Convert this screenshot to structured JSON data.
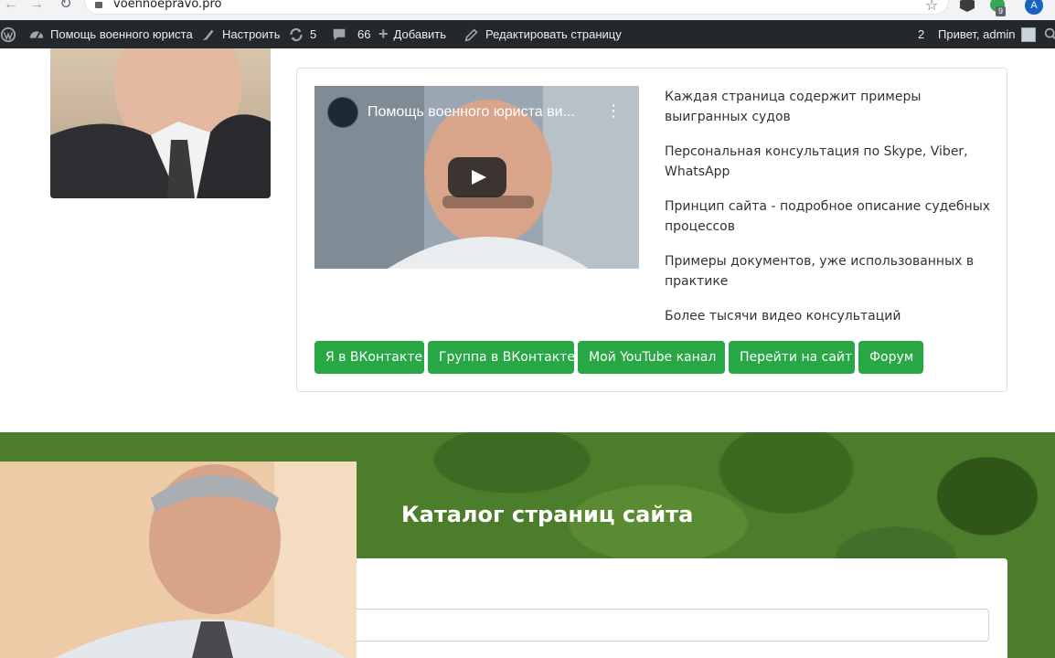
{
  "browser": {
    "url": "voennoepravo.pro",
    "extension_badge": "9",
    "profile_initial": "A"
  },
  "admin_bar": {
    "site_name": "Помощь военного юриста",
    "customize": "Настроить",
    "updates_count": "5",
    "comments_count": "66",
    "add_new": "Добавить",
    "edit_page": "Редактировать страницу",
    "notifications_count": "2",
    "greeting": "Привет, admin"
  },
  "video": {
    "title": "Помощь военного юриста ви..."
  },
  "features": [
    "Каждая страница содержит примеры выигранных судов",
    "Персональная консультация по Skype, Viber, WhatsApp",
    "Принцип сайта - подробное описание судебных процессов",
    "Примеры документов, уже использованных в практике",
    "Более тысячи видео консультаций"
  ],
  "buttons": [
    "Я в ВКонтакте",
    "Группа в ВКонтакте",
    "Мой YouTube канал",
    "Перейти на сайт",
    "Форум"
  ],
  "catalog": {
    "title": "Каталог страниц сайта",
    "search_placeholder": ""
  },
  "colors": {
    "admin_bar": "#23282d",
    "button_green": "#28a745",
    "camo_green": "#4c7d2a"
  }
}
